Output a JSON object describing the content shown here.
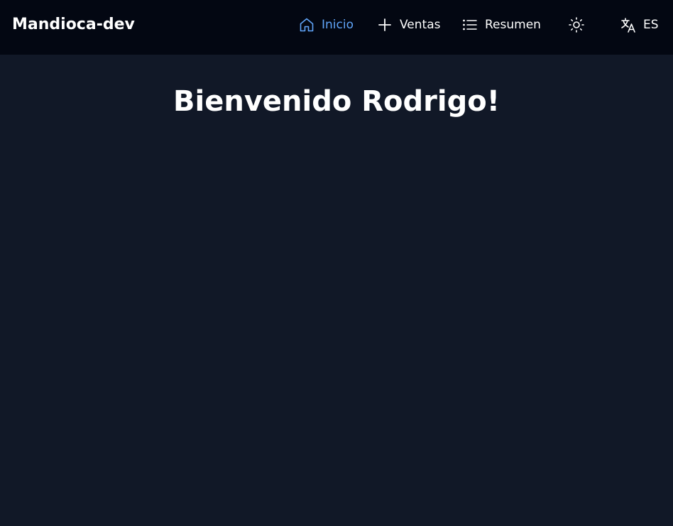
{
  "header": {
    "brand": "Mandioca-dev",
    "nav": {
      "home": {
        "label": "Inicio",
        "icon": "home-icon",
        "active": true
      },
      "sales": {
        "label": "Ventas",
        "icon": "plus-icon"
      },
      "summary": {
        "label": "Resumen",
        "icon": "list-icon"
      }
    },
    "theme_toggle": {
      "icon": "sun-icon"
    },
    "language": {
      "label": "ES",
      "icon": "translate-icon"
    }
  },
  "main": {
    "title": "Bienvenido Rodrigo!"
  },
  "colors": {
    "background": "#111827",
    "navbar": "#030712",
    "accent": "#60a5fa",
    "text": "#ffffff"
  }
}
